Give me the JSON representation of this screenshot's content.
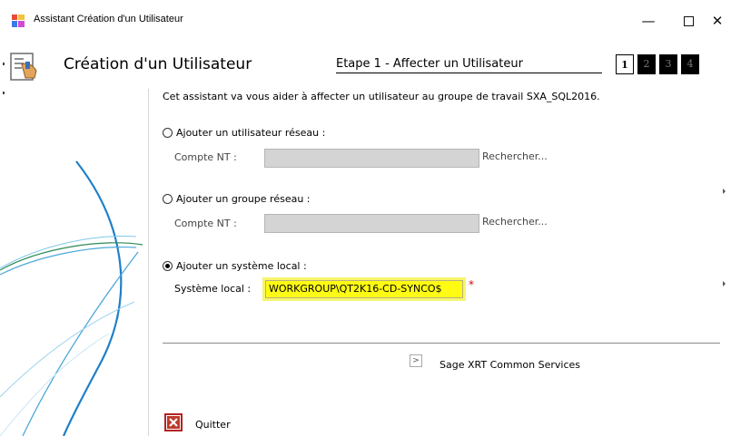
{
  "window": {
    "title": "Assistant Création d'un Utilisateur",
    "controls": {
      "minimize": "—",
      "close": "✕"
    }
  },
  "header": {
    "title": "Création d'un Utilisateur",
    "step_label": "Etape 1 - Affecter un Utilisateur",
    "steps": [
      "1",
      "2",
      "3",
      "4"
    ],
    "current_step": "1"
  },
  "intro": "Cet assistant va vous aider à affecter un utilisateur au groupe de travail SXA_SQL2016.",
  "options": {
    "network_user": {
      "label": "Ajouter un utilisateur réseau :",
      "field_label": "Compte NT :",
      "value": "",
      "search_label": "Rechercher...",
      "selected": false
    },
    "network_group": {
      "label": "Ajouter un groupe réseau :",
      "field_label": "Compte NT :",
      "value": "",
      "search_label": "Rechercher...",
      "selected": false
    },
    "local_system": {
      "label": "Ajouter un système local :",
      "field_label": "Système local :",
      "value": "WORKGROUP\\QT2K16-CD-SYNCO$",
      "required_marker": "*",
      "selected": true
    }
  },
  "footer": {
    "services_arrow": ">",
    "services_label": "Sage XRT Common Services",
    "quit_label": "Quitter"
  },
  "colors": {
    "highlight": "#fffb13",
    "required": "#e00000",
    "quit_icon": "#b22222",
    "panel_swoosh_blue": "#1f7fc9",
    "panel_swoosh_green": "#2e8b57"
  }
}
